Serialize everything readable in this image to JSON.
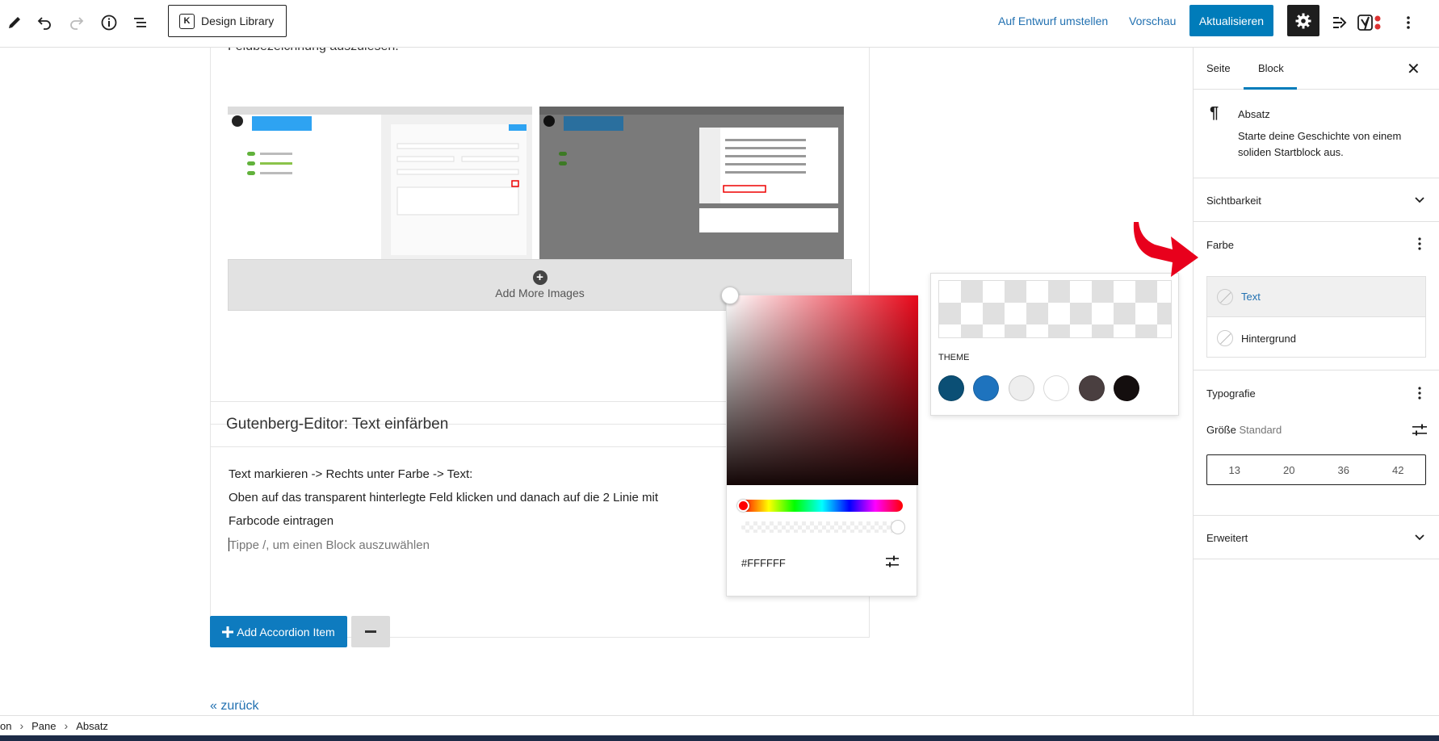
{
  "toolbar": {
    "design_library_label": "Design Library",
    "switch_to_draft_label": "Auf Entwurf umstellen",
    "preview_label": "Vorschau",
    "update_label": "Aktualisieren"
  },
  "editor": {
    "cut_text": "Feldbezeichnung auszulesen.",
    "add_more_images_label": "Add More Images",
    "accordion_title": "Gutenberg-Editor: Text einfärben",
    "paragraphs": [
      "Text markieren -> Rechts unter Farbe -> Text:",
      "Oben auf das transparent hinterlegte Feld klicken und danach auf die 2 Linie mit",
      "Farbcode eintragen"
    ],
    "placeholder": "Tippe /, um einen Block auszuwählen",
    "add_accordion_label": "Add Accordion Item",
    "back_link": "« zurück"
  },
  "color_picker": {
    "hex_value": "#FFFFFF",
    "hue_color": "#e8081a"
  },
  "palette": {
    "theme_label": "THEME",
    "swatches": [
      "#0b4f75",
      "#1e73be",
      "#eeeeee",
      "#ffffff",
      "#4a3f40",
      "#140e0e"
    ]
  },
  "sidebar": {
    "tab_page": "Seite",
    "tab_block": "Block",
    "block_title": "Absatz",
    "block_description": "Starte deine Geschichte von einem soliden Startblock aus.",
    "visibility_label": "Sichtbarkeit",
    "color_label": "Farbe",
    "color_text_label": "Text",
    "color_background_label": "Hintergrund",
    "typography_label": "Typografie",
    "size_label": "Größe",
    "size_value": "Standard",
    "font_sizes": [
      "13",
      "20",
      "36",
      "42"
    ],
    "advanced_label": "Erweitert"
  },
  "breadcrumb": [
    "on",
    "Pane",
    "Absatz"
  ],
  "colors": {
    "accent": "#007cba",
    "annotation_arrow": "#e8001c"
  }
}
